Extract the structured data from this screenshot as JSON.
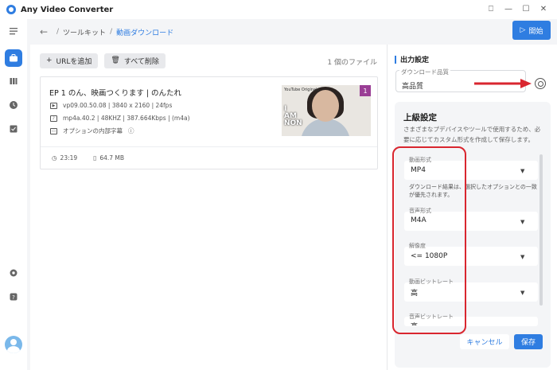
{
  "window": {
    "title": "Any Video Converter",
    "controls": [
      "⎕",
      "—",
      "☐",
      "✕"
    ]
  },
  "header": {
    "breadcrumb": [
      "ツールキット",
      "動画ダウンロード"
    ],
    "start_label": "開始"
  },
  "toolbar": {
    "add_url": "URLを追加",
    "delete_all": "すべて削除",
    "file_count": "1 個のファイル"
  },
  "card": {
    "title": "EP 1 のん、映画つくります | のんたれ",
    "video_info": "vp09.00.50.08 | 3840 x 2160 | 24fps",
    "audio_info": "mp4a.40.2 | 48KHZ | 387.664Kbps | (m4a)",
    "subtitle_info": "オプションの内部字幕",
    "duration": "23:19",
    "size": "64.7 MB",
    "thumb_brand": "YouTube Originals",
    "thumb_text": "I\nAM\nNON",
    "thumb_number": "1"
  },
  "output": {
    "heading": "出力設定",
    "quality_label": "ダウンロード品質",
    "quality_value": "高品質"
  },
  "advanced": {
    "heading": "上級設定",
    "description": "さまざまなプデバイスやツールで使用するため、必要に応じてカスタム形式を作成して保存します。",
    "video_format_label": "動画形式",
    "video_format_value": "MP4",
    "note": "ダウンロード結果は、選択したオプションとの一致が優先されます。",
    "audio_format_label": "音声形式",
    "audio_format_value": "M4A",
    "resolution_label": "解像度",
    "resolution_value": "<= 1080P",
    "video_bitrate_label": "動画ビットレート",
    "video_bitrate_value": "高",
    "audio_bitrate_label": "音声ビットレート",
    "audio_bitrate_value": "高"
  },
  "buttons": {
    "cancel": "キャンセル",
    "save": "保存"
  },
  "colors": {
    "accent": "#2f7de1",
    "highlight": "#d9262f"
  }
}
